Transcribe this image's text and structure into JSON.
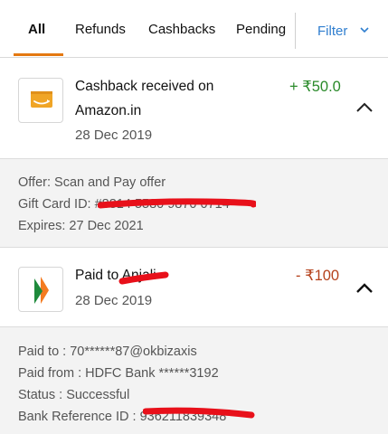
{
  "tabs": {
    "all": "All",
    "refunds": "Refunds",
    "cashbacks": "Cashbacks",
    "pending": "Pending",
    "filter": "Filter"
  },
  "transactions": [
    {
      "title_line1": "Cashback received on",
      "title_line2": "Amazon.in",
      "date": "28 Dec 2019",
      "amount": "+ ₹50.0",
      "icon": "gift-card-icon",
      "details": [
        "Offer: Scan and Pay offer",
        "Gift Card ID: #8814 5580 9870 0714",
        "Expires: 27 Dec 2021"
      ]
    },
    {
      "title_line1": "Paid to Anjali",
      "date": "28 Dec 2019",
      "amount": "- ₹100",
      "icon": "bhim-upi-icon",
      "details": [
        "Paid to : 70******87@okbizaxis",
        "Paid from : HDFC Bank ******3192",
        "Status : Successful",
        "Bank Reference ID : 936211839348"
      ]
    }
  ],
  "colors": {
    "accent": "#e47911",
    "link": "#2f7ecf",
    "credit": "#2a8a2a",
    "debit": "#b5421c",
    "redaction": "#e8101a"
  }
}
